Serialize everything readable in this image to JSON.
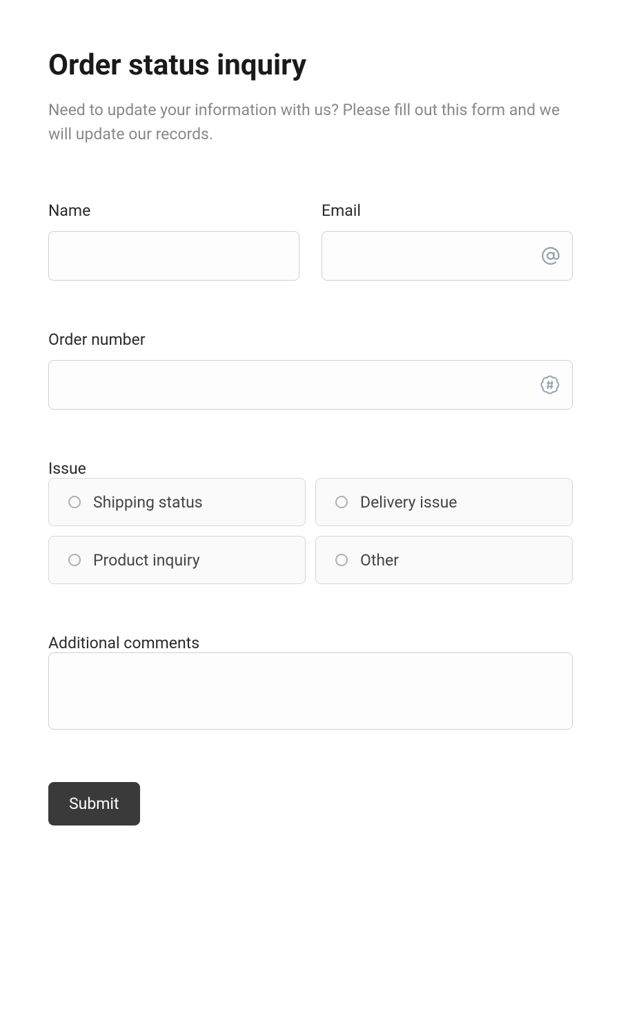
{
  "title": "Order status inquiry",
  "subtitle": "Need to update your information with us? Please fill out this form and we will update our records.",
  "fields": {
    "name": {
      "label": "Name",
      "value": ""
    },
    "email": {
      "label": "Email",
      "value": ""
    },
    "order_number": {
      "label": "Order number",
      "value": ""
    },
    "issue": {
      "label": "Issue",
      "options": [
        "Shipping status",
        "Delivery issue",
        "Product inquiry",
        "Other"
      ]
    },
    "comments": {
      "label": "Additional comments",
      "value": ""
    }
  },
  "submit_label": "Submit"
}
